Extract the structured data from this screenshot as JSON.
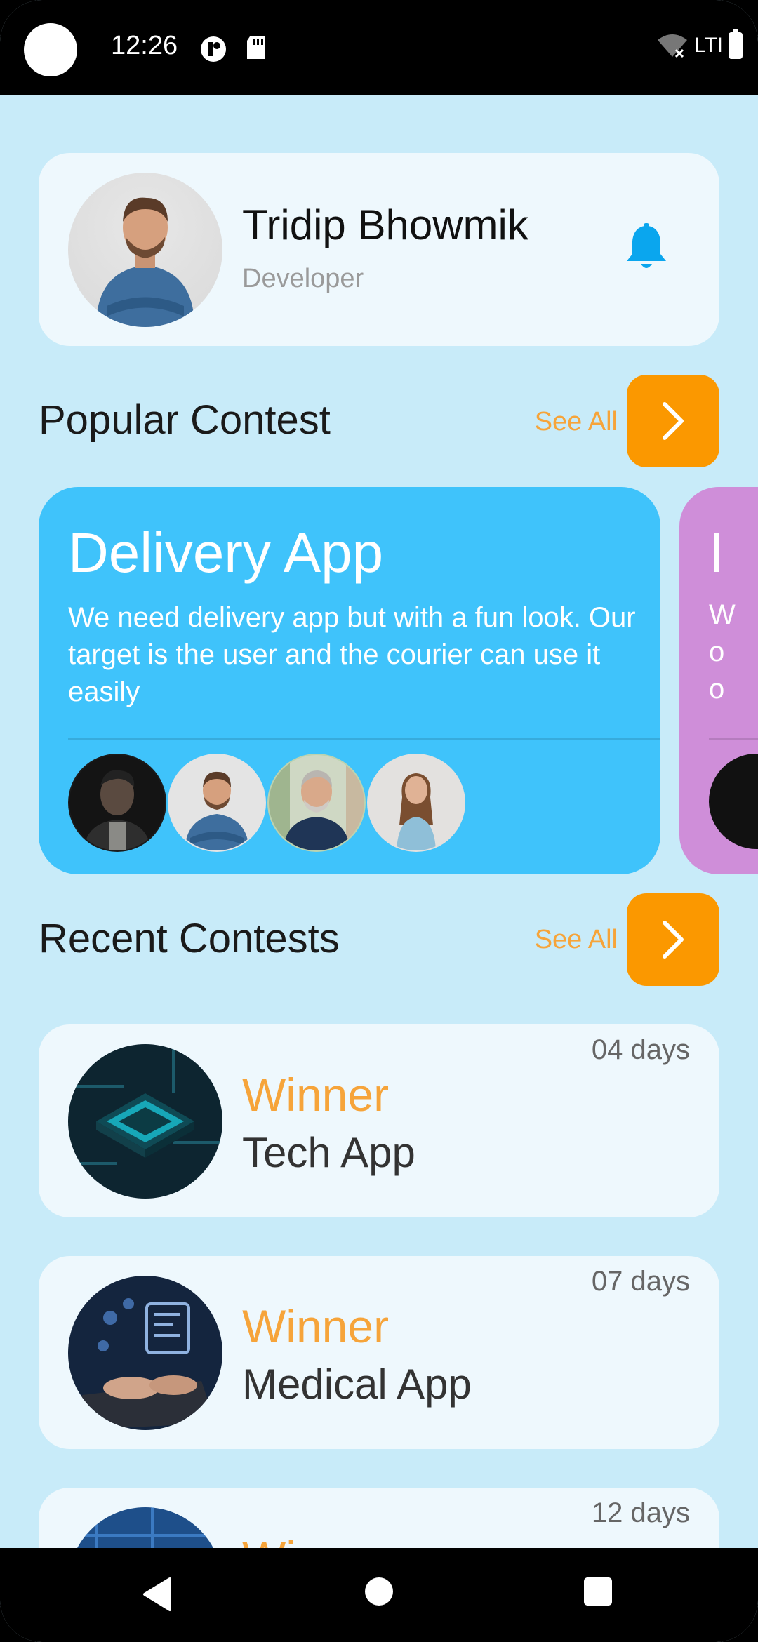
{
  "status_bar": {
    "time": "12:26",
    "network_label": "LTI",
    "icons": [
      "circle-status-icon",
      "sd-card-icon",
      "wifi-off-icon",
      "battery-icon"
    ]
  },
  "profile": {
    "name": "Tridip Bhowmik",
    "role": "Developer",
    "avatar": "man-crossed-arms-avatar",
    "notification_icon": "bell-icon",
    "accent": "#0aa6ee"
  },
  "popular": {
    "title": "Popular Contest",
    "see_all": "See All",
    "cards": [
      {
        "title": "Delivery App",
        "description": "We need delivery app but with a fun look. Our target is the user and the courier can use it easily",
        "color": "#3fc3fb",
        "participants": [
          "man-dark-portrait",
          "man-crossed-arms",
          "older-man-smiling",
          "woman-standing"
        ]
      },
      {
        "title": "I",
        "description_peek": [
          "W",
          "o",
          "o"
        ],
        "color": "#cf8ed9"
      }
    ]
  },
  "recent": {
    "title": "Recent Contests",
    "see_all": "See All",
    "items": [
      {
        "days": "04 days",
        "status": "Winner",
        "name": "Tech App",
        "thumb": "circuit-chip-image"
      },
      {
        "days": "07 days",
        "status": "Winner",
        "name": "Medical App",
        "thumb": "laptop-hands-image"
      },
      {
        "days": "12 days",
        "status": "Winner",
        "name": "",
        "thumb": "blue-tech-image"
      }
    ]
  },
  "colors": {
    "background": "#c8ebf9",
    "card": "#eef8fd",
    "orange": "#fb9800",
    "winner": "#f6a43a"
  }
}
